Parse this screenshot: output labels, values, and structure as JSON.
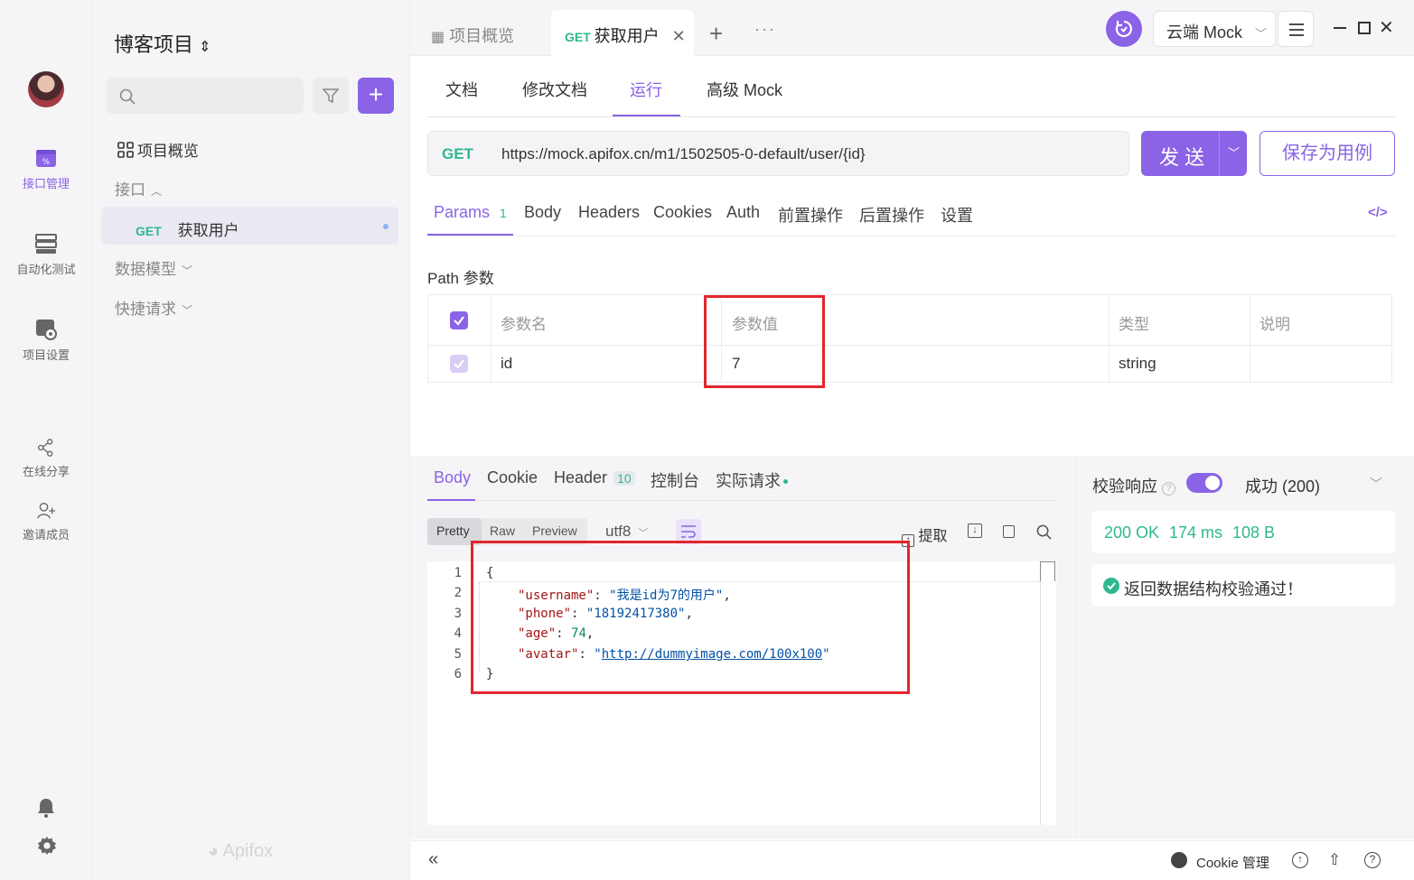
{
  "rail": {
    "items": [
      {
        "label": "接口管理"
      },
      {
        "label": "自动化测试"
      },
      {
        "label": "项目设置"
      },
      {
        "label": "在线分享"
      },
      {
        "label": "邀请成员"
      }
    ]
  },
  "sidebar": {
    "project_title": "博客项目",
    "overview": "项目概览",
    "api_group": "接口",
    "selected_method": "GET",
    "selected_name": "获取用户",
    "data_model": "数据模型",
    "quick_request": "快捷请求",
    "brand": "Apifox"
  },
  "tabs": {
    "overview": "项目概览",
    "active_method": "GET",
    "active_name": "获取用户"
  },
  "topbar": {
    "mock_env": "云端 Mock"
  },
  "subtabs": [
    "文档",
    "修改文档",
    "运行",
    "高级 Mock"
  ],
  "request": {
    "method": "GET",
    "url": "https://mock.apifox.cn/m1/1502505-0-default/user/{id}",
    "send": "发 送",
    "save": "保存为用例"
  },
  "param_tabs": {
    "params": "Params",
    "params_count": "1",
    "body": "Body",
    "headers": "Headers",
    "cookies": "Cookies",
    "auth": "Auth",
    "pre": "前置操作",
    "post": "后置操作",
    "settings": "设置"
  },
  "path_params": {
    "title": "Path 参数",
    "headers": [
      "参数名",
      "参数值",
      "类型",
      "说明"
    ],
    "row": {
      "name": "id",
      "value": "7",
      "type": "string",
      "desc": ""
    }
  },
  "response": {
    "tabs": {
      "body": "Body",
      "cookie": "Cookie",
      "header": "Header",
      "header_count": "10",
      "console": "控制台",
      "actual": "实际请求"
    },
    "formats": [
      "Pretty",
      "Raw",
      "Preview"
    ],
    "encoding": "utf8",
    "extract": "提取",
    "line_numbers": [
      "1",
      "2",
      "3",
      "4",
      "5",
      "6"
    ],
    "json": {
      "username": "我是id为7的用户",
      "phone": "18192417380",
      "age": "74",
      "avatar": "http://dummyimage.com/100x100"
    }
  },
  "validation": {
    "label": "校验响应",
    "result": "成功 (200)",
    "status": "200 OK",
    "time": "174 ms",
    "size": "108 B",
    "message": "返回数据结构校验通过！"
  },
  "footer": {
    "cookie_manage": "Cookie 管理"
  }
}
